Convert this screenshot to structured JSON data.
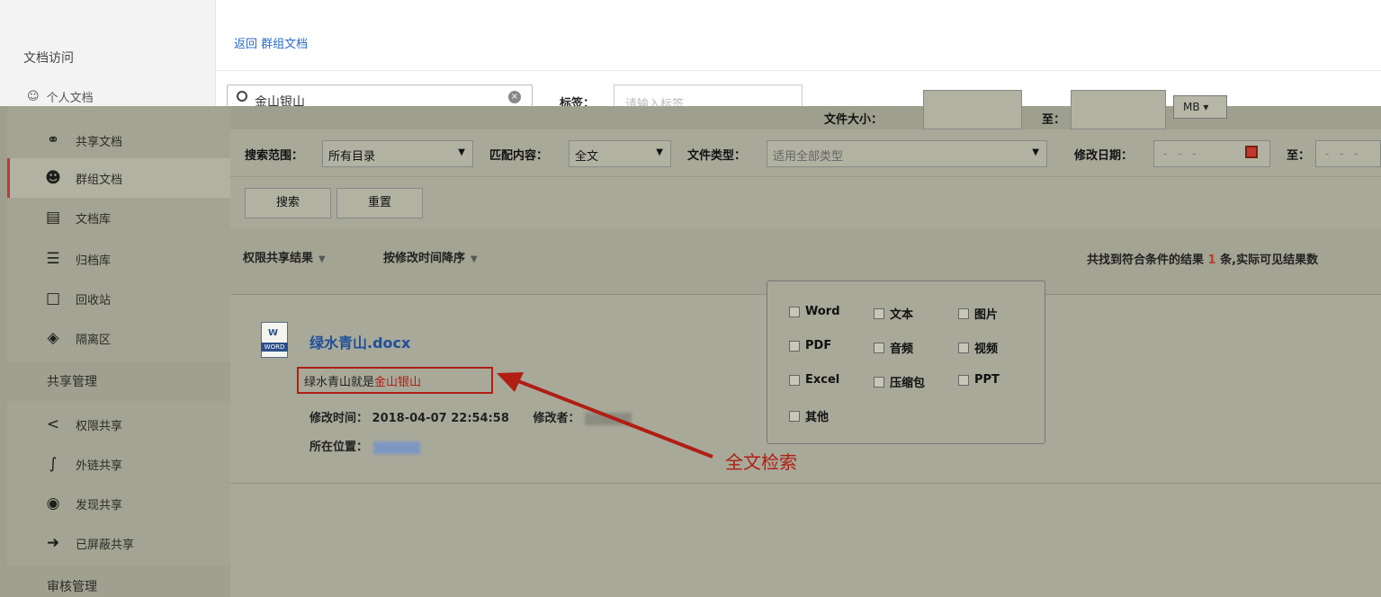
{
  "sidebar": {
    "section_doc_access": "文档访问",
    "personal_docs": "个人文档",
    "items": [
      {
        "label": "共享文档",
        "icon": "share-icon"
      },
      {
        "label": "群组文档",
        "icon": "group-icon"
      },
      {
        "label": "文档库",
        "icon": "library-icon"
      },
      {
        "label": "归档库",
        "icon": "archive-icon"
      },
      {
        "label": "回收站",
        "icon": "trash-icon"
      },
      {
        "label": "隔离区",
        "icon": "quarantine-icon"
      }
    ],
    "section_share_mgmt": "共享管理",
    "share_items": [
      {
        "label": "权限共享",
        "icon": "permission-share-icon"
      },
      {
        "label": "外链共享",
        "icon": "link-share-icon"
      },
      {
        "label": "发现共享",
        "icon": "eye-icon"
      },
      {
        "label": "已屏蔽共享",
        "icon": "blocked-share-icon"
      }
    ],
    "section_audit": "审核管理"
  },
  "header": {
    "back_link": "返回 群组文档"
  },
  "search": {
    "keyword": "金山银山",
    "tag_label": "标签：",
    "tag_placeholder": "请输入标签",
    "file_size_label": "文件大小：",
    "to_label": "至：",
    "size_unit": "MB ▾"
  },
  "filters": {
    "scope_label": "搜索范围：",
    "scope_value": "所有目录",
    "match_label": "匹配内容：",
    "match_value": "全文",
    "type_label": "文件类型：",
    "type_placeholder": "适用全部类型",
    "date_label": "修改日期：",
    "date_placeholder": "- - -",
    "date_to_label": "至：",
    "date_to_placeholder": "- - -"
  },
  "buttons": {
    "search": "搜索",
    "reset": "重置"
  },
  "file_types": [
    "Word",
    "文本",
    "图片",
    "PDF",
    "音频",
    "视频",
    "Excel",
    "压缩包",
    "PPT",
    "其他"
  ],
  "results_bar": {
    "sort_permission": "权限共享结果",
    "sort_time": "按修改时间降序",
    "count_prefix": "共找到符合条件的结果",
    "count_value": "1",
    "count_suffix": "条,实际可见结果数"
  },
  "result": {
    "title": "绿水青山.docx",
    "snippet_plain": "绿水青山就是",
    "snippet_hl": "金山银山",
    "modified_label": "修改时间：",
    "modified_value": "2018-04-07 22:54:58",
    "modifier_label": "修改者：",
    "location_label": "所在位置："
  },
  "annotation": "全文检索",
  "colors": {
    "accent_red": "#b01e14",
    "link_blue": "#2a6cc7",
    "overlay": "#a8a999"
  }
}
